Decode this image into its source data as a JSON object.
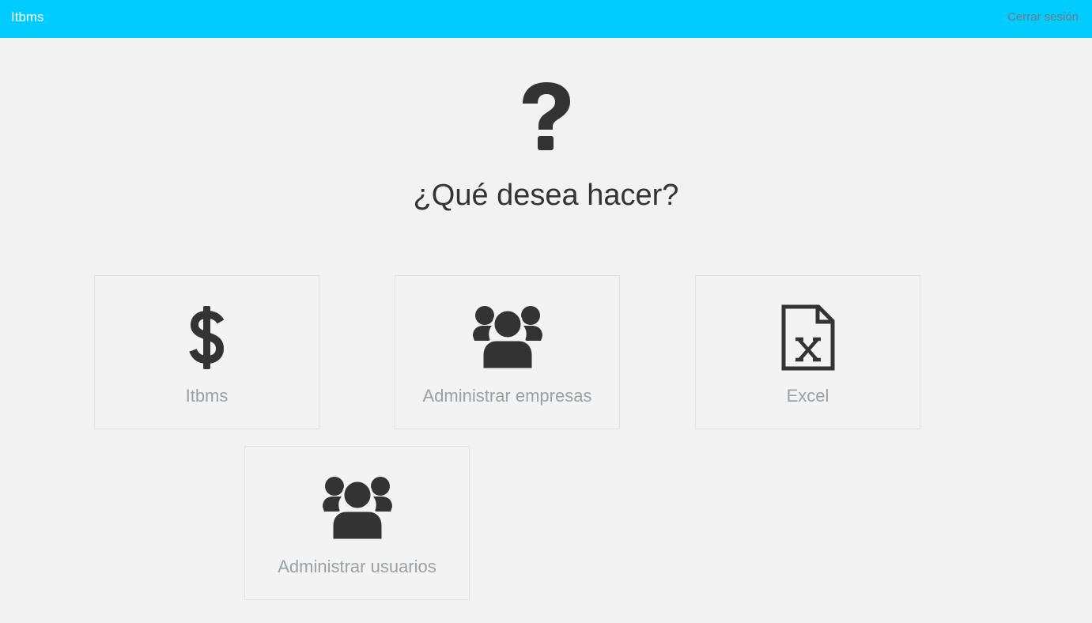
{
  "navbar": {
    "brand": "Itbms",
    "logout_label": "Cerrar sesión"
  },
  "main": {
    "hero_icon": "question-icon",
    "title": "¿Qué desea hacer?",
    "tiles": [
      {
        "label": "Itbms",
        "icon": "dollar-icon"
      },
      {
        "label": "Administrar empresas",
        "icon": "users-icon"
      },
      {
        "label": "Excel",
        "icon": "file-excel-icon"
      },
      {
        "label": "Administrar usuarios",
        "icon": "users-icon"
      }
    ]
  },
  "colors": {
    "navbar_bg": "#00ccff",
    "page_bg": "#f2f2f2",
    "icon": "#333333",
    "tile_label": "#9aa0a4"
  }
}
